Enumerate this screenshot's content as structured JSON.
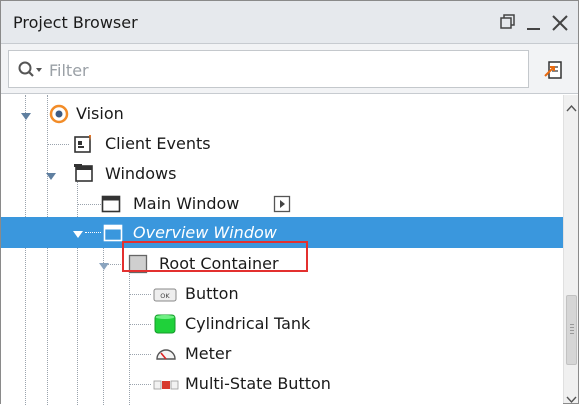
{
  "panel": {
    "title": "Project Browser",
    "restore_icon": "restore-icon",
    "minimize_icon": "minimize-icon",
    "close_icon": "close-icon"
  },
  "filter": {
    "placeholder": "Filter",
    "value": "",
    "search_icon": "search-dropdown-icon",
    "link_icon": "link-with-editor-icon"
  },
  "tree": {
    "items": [
      {
        "label": "Vision",
        "icon": "vision-module-icon",
        "expanded": true,
        "selected": false
      },
      {
        "label": "Client Events",
        "icon": "client-events-icon",
        "selected": false
      },
      {
        "label": "Windows",
        "icon": "windows-folder-icon",
        "expanded": true,
        "selected": false
      },
      {
        "label": "Main Window",
        "icon": "window-icon",
        "selected": false,
        "badge_icon": "open-window-icon"
      },
      {
        "label": "Overview Window",
        "icon": "window-icon",
        "expanded": true,
        "selected": true
      },
      {
        "label": "Root Container",
        "icon": "root-container-icon",
        "expanded": true,
        "selected": false
      },
      {
        "label": "Button",
        "icon": "button-component-icon",
        "selected": false
      },
      {
        "label": "Cylindrical Tank",
        "icon": "cylindrical-tank-icon",
        "selected": false
      },
      {
        "label": "Meter",
        "icon": "meter-icon",
        "selected": false,
        "highlighted": true
      },
      {
        "label": "Multi-State Button",
        "icon": "multi-state-button-icon",
        "selected": false
      }
    ]
  },
  "colors": {
    "selection": "#3a97dd",
    "highlight_outline": "#e3302f",
    "vision_orange": "#f28c28",
    "tank_green": "#1fd13a"
  }
}
